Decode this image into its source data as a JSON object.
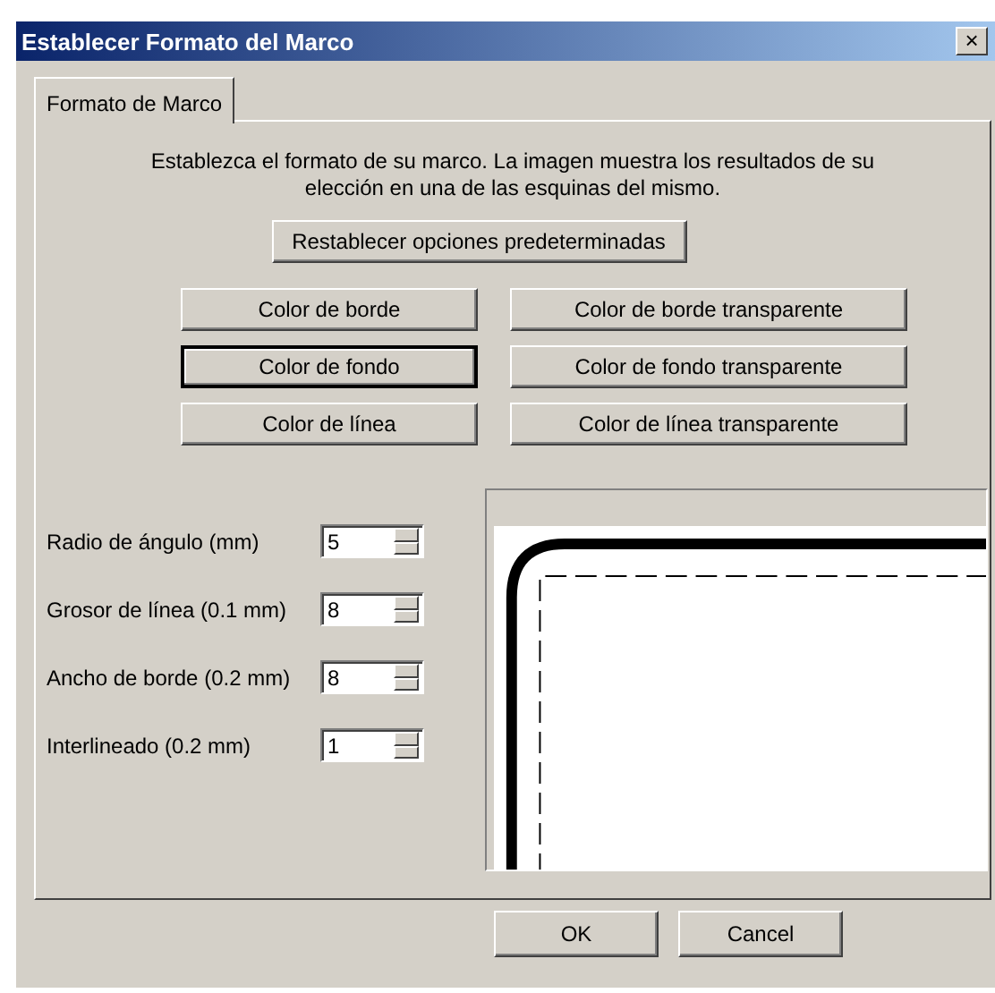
{
  "window": {
    "title": "Establecer Formato del Marco",
    "close": "×"
  },
  "tabs": [
    {
      "label": "Formato de Marco",
      "selected": true
    }
  ],
  "description": "Establezca el formato de su marco. La imagen muestra los resultados de su elección en una de las esquinas del mismo.",
  "reset_button": "Restablecer opciones predeterminadas",
  "color_buttons": [
    {
      "label": "Color de borde",
      "focused": false
    },
    {
      "label": "Color de borde transparente",
      "focused": false
    },
    {
      "label": "Color de fondo",
      "focused": true
    },
    {
      "label": "Color de fondo transparente",
      "focused": false
    },
    {
      "label": "Color de línea",
      "focused": false
    },
    {
      "label": "Color de línea transparente",
      "focused": false
    }
  ],
  "fields": [
    {
      "label": "Radio de ángulo (mm)",
      "value": "5"
    },
    {
      "label": "Grosor de línea (0.1 mm)",
      "value": "8"
    },
    {
      "label": "Ancho de borde (0.2 mm)",
      "value": "8"
    },
    {
      "label": "Interlineado (0.2 mm)",
      "value": "1"
    }
  ],
  "buttons": [
    "OK",
    "Cancel"
  ]
}
